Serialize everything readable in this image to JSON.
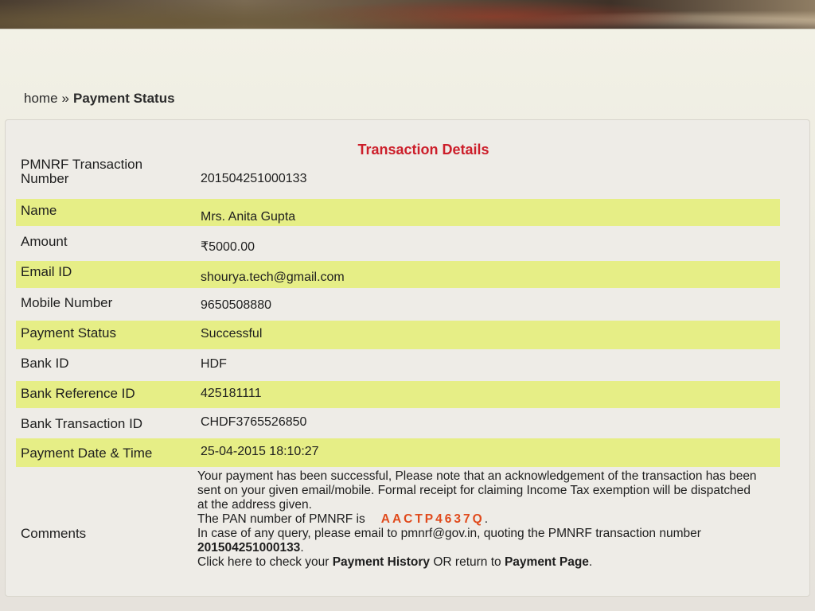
{
  "breadcrumb": {
    "home": "home",
    "separator": "»",
    "current": "Payment Status"
  },
  "panel": {
    "title": "Transaction Details"
  },
  "details": [
    {
      "label": "PMNRF Transaction Number",
      "value": "201504251000133"
    },
    {
      "label": "Name",
      "value": "Mrs. Anita Gupta"
    },
    {
      "label": "Amount",
      "value": "₹5000.00"
    },
    {
      "label": "Email ID",
      "value": "shourya.tech@gmail.com"
    },
    {
      "label": "Mobile Number",
      "value": "9650508880"
    },
    {
      "label": "Payment Status",
      "value": "Successful"
    },
    {
      "label": "Bank ID",
      "value": "HDF"
    },
    {
      "label": "Bank Reference ID",
      "value": "425181111"
    },
    {
      "label": "Bank Transaction ID",
      "value": "CHDF3765526850"
    },
    {
      "label": "Payment Date & Time",
      "value": "25-04-2015 18:10:27"
    }
  ],
  "comments": {
    "label": "Comments",
    "line1": "Your payment has been successful, Please note that an acknowledgement of the transaction has been sent on your given email/mobile. Formal receipt for claiming Income Tax exemption will be dispatched at the address given.",
    "pan_prefix": "The PAN number of PMNRF is",
    "pan_value": "AACTP4637Q",
    "pan_suffix": ".",
    "query_text": "In case of any query, please email to pmnrf@gov.in, quoting the PMNRF transaction number",
    "txn_number": "201504251000133",
    "txn_suffix": ".",
    "click_prefix": "Click here to check your",
    "payment_history_link": "Payment History",
    "or_text": "OR return to",
    "payment_page_link": "Payment Page",
    "end": "."
  }
}
